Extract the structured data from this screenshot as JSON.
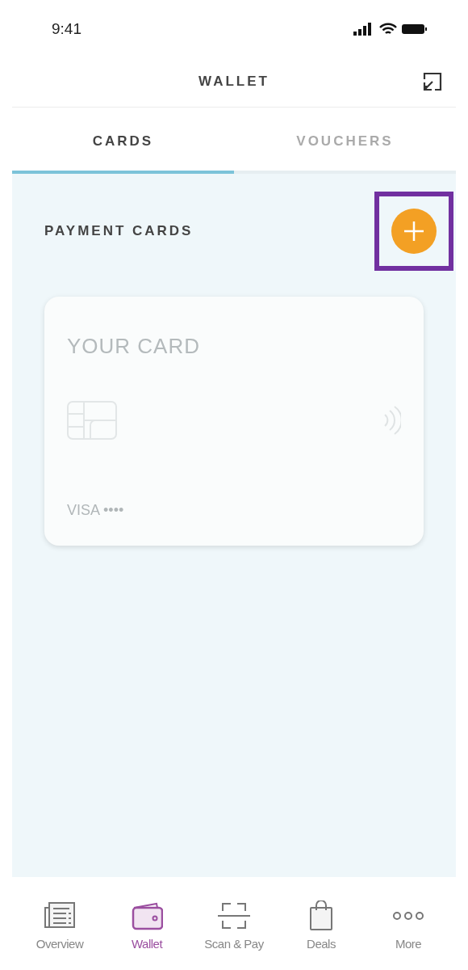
{
  "status_bar": {
    "time": "9:41"
  },
  "header": {
    "title": "WALLET"
  },
  "tabs": [
    {
      "label": "CARDS",
      "selected": true
    },
    {
      "label": "VOUCHERS",
      "selected": false
    }
  ],
  "section": {
    "title": "PAYMENT CARDS",
    "add_button": {
      "highlighted": true
    }
  },
  "card": {
    "title": "YOUR CARD",
    "network": "VISA ••••"
  },
  "bottom_nav": [
    {
      "kind": "overview",
      "label": "Overview",
      "selected": false
    },
    {
      "kind": "wallet",
      "label": "Wallet",
      "selected": true
    },
    {
      "kind": "scan",
      "label": "Scan & Pay",
      "selected": false
    },
    {
      "kind": "deals",
      "label": "Deals",
      "selected": false
    },
    {
      "kind": "more",
      "label": "More",
      "selected": false
    }
  ]
}
